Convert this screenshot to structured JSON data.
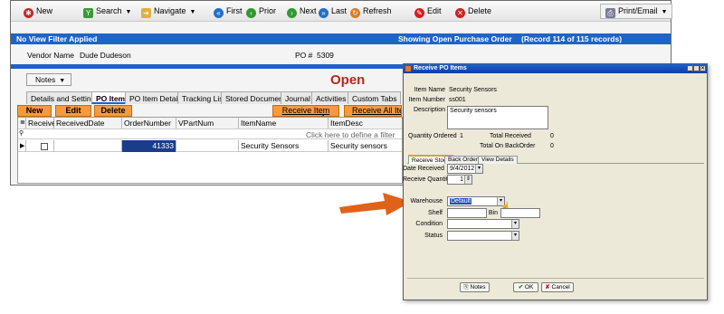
{
  "toolbar": {
    "new": "New",
    "search": "Search",
    "navigate": "Navigate",
    "first": "First",
    "prior": "Prior",
    "next": "Next",
    "last": "Last",
    "refresh": "Refresh",
    "edit": "Edit",
    "delete": "Delete",
    "print_email": "Print/Email"
  },
  "status_bar": {
    "filter": "No View Filter Applied",
    "showing": "Showing Open Purchase Order",
    "record": "(Record 114 of 115 records)"
  },
  "header": {
    "vendor_label": "Vendor Name",
    "vendor_value": "Dude Dudeson",
    "po_label": "PO #",
    "po_value": "5309",
    "notes_dropdown": "Notes",
    "status": "Open"
  },
  "tabs": [
    "Details and Settings",
    "PO Items",
    "PO Item Details",
    "Tracking List",
    "Stored Documents",
    "Journal",
    "Activities",
    "Custom Tabs"
  ],
  "actions": {
    "new": "New",
    "edit": "Edit",
    "delete": "Delete",
    "receive_item": "Receive Item",
    "receive_all": "Receive All Item"
  },
  "grid": {
    "columns": [
      "Received",
      "ReceivedDate",
      "OrderNumber",
      "VPartNum",
      "ItemName",
      "ItemDesc"
    ],
    "filter_hint": "Click here to define a filter",
    "rows": [
      {
        "received": "",
        "received_date": "",
        "order_number": "41333",
        "vpartnum": "",
        "item_name": "Security Sensors",
        "item_desc": "Security sensors"
      }
    ]
  },
  "dialog": {
    "title": "Receive PO Items",
    "item_name_label": "Item Name",
    "item_name": "Security Sensors",
    "item_number_label": "Item Number",
    "item_number": "ss001",
    "description_label": "Description",
    "description": "Security sensors",
    "qty_ordered_label": "Quantity Ordered",
    "qty_ordered": "1",
    "total_received_label": "Total Received",
    "total_received": "0",
    "total_backorder_label": "Total On BackOrder",
    "total_backorder": "0",
    "tabs": [
      "Receive Stock",
      "Back Order",
      "View Details"
    ],
    "date_received_label": "Date Received",
    "date_received": "9/4/2012",
    "receive_qty_label": "Receive Quantity",
    "receive_qty": "1",
    "warehouse_label": "Warehouse",
    "warehouse": "Default",
    "shelf_label": "Shelf",
    "bin_label": "Bin",
    "condition_label": "Condition",
    "status_label": "Status",
    "notes_button": "Notes",
    "ok_button": "OK",
    "cancel_button": "Cancel"
  },
  "colors": {
    "accent_blue": "#1f63c8",
    "orange_button": "#f79a3e",
    "arrow": "#e0621a"
  }
}
